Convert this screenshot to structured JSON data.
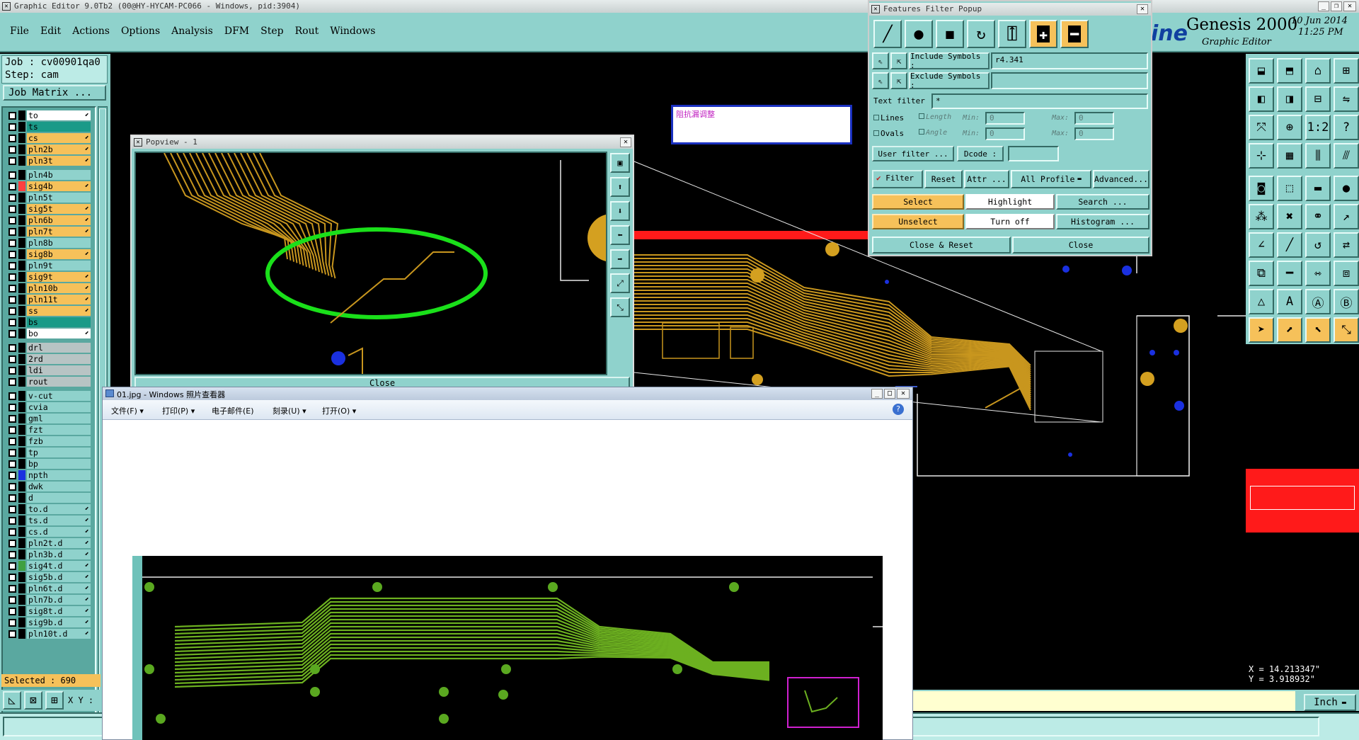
{
  "app": {
    "title": "Graphic Editor 9.0Tb2  (00@HY-HYCAM-PC066 - Windows, pid:3904)",
    "brand": "Genesis 2000",
    "brand_sub": "Graphic Editor",
    "brand_logo": "ine",
    "date": "10 Jun 2014",
    "time": "11:25 PM"
  },
  "menu": [
    "File",
    "Edit",
    "Actions",
    "Options",
    "Analysis",
    "DFM",
    "Step",
    "Rout",
    "Windows"
  ],
  "job": {
    "job_label": "Job : cv00901qa0",
    "step_label": "Step: cam",
    "matrix_button": "Job Matrix ..."
  },
  "layers": [
    {
      "name": "to",
      "color": "#ffffff"
    },
    {
      "name": "ts",
      "color": "#1a9a88"
    },
    {
      "name": "cs",
      "color": "#f6c15a"
    },
    {
      "name": "pln2b",
      "color": "#f6c15a"
    },
    {
      "name": "pln3t",
      "color": "#f6c15a"
    },
    {
      "name": "pln4b",
      "color": "#8fd2cc"
    },
    {
      "name": "sig4b",
      "color": "#f6c15a"
    },
    {
      "name": "pln5t",
      "color": "#8fd2cc"
    },
    {
      "name": "sig5t",
      "color": "#f6c15a"
    },
    {
      "name": "pln6b",
      "color": "#f6c15a"
    },
    {
      "name": "pln7t",
      "color": "#f6c15a"
    },
    {
      "name": "pln8b",
      "color": "#8fd2cc"
    },
    {
      "name": "sig8b",
      "color": "#f6c15a"
    },
    {
      "name": "pln9t",
      "color": "#8fd2cc"
    },
    {
      "name": "sig9t",
      "color": "#f6c15a"
    },
    {
      "name": "pln10b",
      "color": "#f6c15a"
    },
    {
      "name": "pln11t",
      "color": "#f6c15a"
    },
    {
      "name": "ss",
      "color": "#f6c15a"
    },
    {
      "name": "bs",
      "color": "#1a9a88"
    },
    {
      "name": "bo",
      "color": "#ffffff"
    },
    {
      "name": "drl",
      "color": "#b8c4c4"
    },
    {
      "name": "2rd",
      "color": "#b8c4c4"
    },
    {
      "name": "ldi",
      "color": "#b8c4c4"
    },
    {
      "name": "rout",
      "color": "#b8c4c4"
    },
    {
      "name": "v-cut",
      "color": "#8fd2cc"
    },
    {
      "name": "cvia",
      "color": "#8fd2cc"
    },
    {
      "name": "gml",
      "color": "#8fd2cc"
    },
    {
      "name": "fzt",
      "color": "#8fd2cc"
    },
    {
      "name": "fzb",
      "color": "#8fd2cc"
    },
    {
      "name": "tp",
      "color": "#8fd2cc"
    },
    {
      "name": "bp",
      "color": "#8fd2cc"
    },
    {
      "name": "npth",
      "color": "#8fd2cc"
    },
    {
      "name": "dwk",
      "color": "#8fd2cc"
    },
    {
      "name": "d",
      "color": "#8fd2cc"
    },
    {
      "name": "to.d",
      "color": "#8fd2cc"
    },
    {
      "name": "ts.d",
      "color": "#8fd2cc"
    },
    {
      "name": "cs.d",
      "color": "#8fd2cc"
    },
    {
      "name": "pln2t.d",
      "color": "#8fd2cc"
    },
    {
      "name": "pln3b.d",
      "color": "#8fd2cc"
    },
    {
      "name": "sig4t.d",
      "color": "#8fd2cc"
    },
    {
      "name": "sig5b.d",
      "color": "#8fd2cc"
    },
    {
      "name": "pln6t.d",
      "color": "#8fd2cc"
    },
    {
      "name": "pln7b.d",
      "color": "#8fd2cc"
    },
    {
      "name": "sig8t.d",
      "color": "#8fd2cc"
    },
    {
      "name": "sig9b.d",
      "color": "#8fd2cc"
    },
    {
      "name": "pln10t.d",
      "color": "#8fd2cc"
    }
  ],
  "status": {
    "selected": "Selected : 690",
    "xy_label": "X Y :",
    "x_coord": "X = 14.213347\"",
    "y_coord": "Y = 3.918932\"",
    "units": "Inch"
  },
  "popview": {
    "title": "Popview - 1",
    "close_label": "Close"
  },
  "annotation": {
    "text": "阻抗漏调整"
  },
  "ffp": {
    "title": "Features Filter Popup",
    "include_label": "Include Symbols :",
    "include_value": "r4.341",
    "exclude_label": "Exclude Symbols :",
    "exclude_value": "",
    "text_filter_label": "Text filter",
    "text_filter_value": "*",
    "lines_label": "Lines",
    "ovals_label": "Ovals",
    "length_label": "Length",
    "angle_label": "Angle",
    "min_label": "Min:",
    "max_label": "Max:",
    "len_min": "0",
    "len_max": "0",
    "ang_min": "0",
    "ang_max": "0",
    "user_filter": "User filter ...",
    "dcode": "Dcode :",
    "dcode_value": "",
    "filter": "Filter",
    "reset": "Reset",
    "attr": "Attr ...",
    "all_profile": "All Profile",
    "advanced": "Advanced...",
    "select": "Select",
    "highlight": "Highlight",
    "search": "Search ...",
    "unselect": "Unselect",
    "turn_off": "Turn off",
    "histogram": "Histogram ...",
    "close_reset": "Close & Reset",
    "close": "Close"
  },
  "photo_viewer": {
    "title": "01.jpg - Windows 照片查看器",
    "menu": [
      "文件(F)",
      "打印(P)",
      "电子邮件(E)",
      "刻录(U)",
      "打开(O)"
    ]
  }
}
